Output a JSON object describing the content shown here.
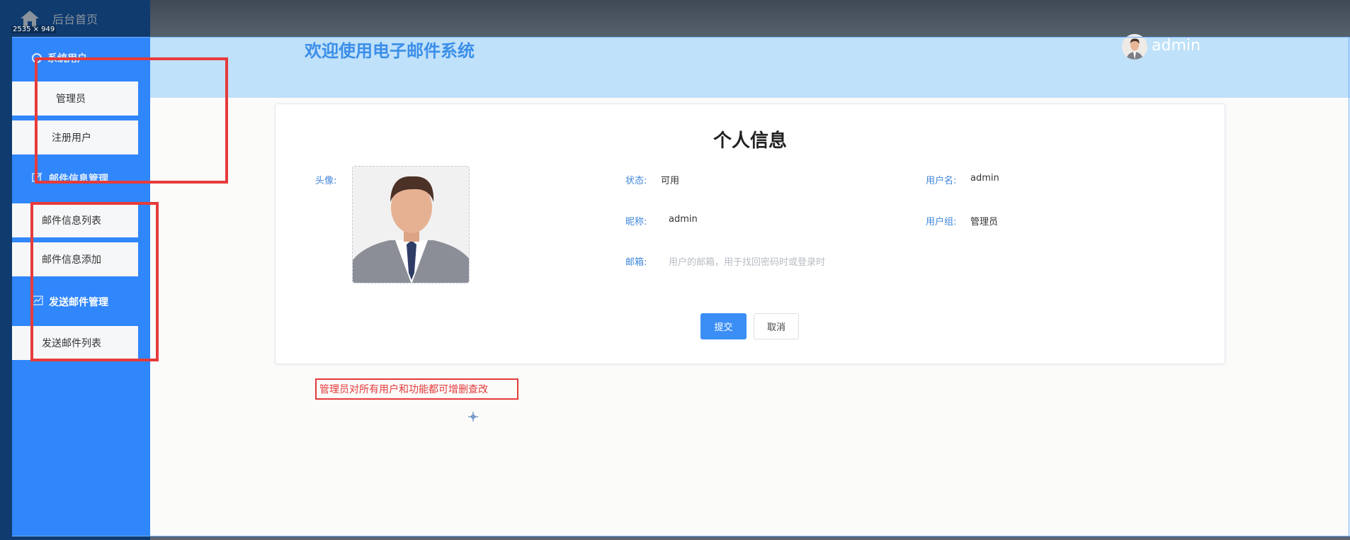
{
  "topbar": {
    "home_label": "后台首页",
    "dim_badge": "2535 × 949"
  },
  "sidebar": {
    "groups": [
      {
        "label": "系统用户",
        "icon": "user-icon"
      },
      {
        "label": "邮件信息管理",
        "icon": "edit-icon"
      },
      {
        "label": "发送邮件管理",
        "icon": "chart-icon"
      }
    ],
    "items": [
      {
        "label": "管理员"
      },
      {
        "label": "注册用户"
      },
      {
        "label": "邮件信息列表"
      },
      {
        "label": "邮件信息添加"
      },
      {
        "label": "发送邮件列表"
      }
    ]
  },
  "header": {
    "title": "欢迎使用电子邮件系统",
    "user": "admin"
  },
  "profile": {
    "title": "个人信息",
    "avatar_label": "头像:",
    "status_label": "状态:",
    "status_value": "可用",
    "username_label": "用户名:",
    "username_value": "admin",
    "nickname_label": "昵称:",
    "nickname_value": "admin",
    "group_label": "用户组:",
    "group_value": "管理员",
    "email_label": "邮箱:",
    "email_placeholder": "用户的邮箱，用于找回密码时或登录时",
    "submit": "提交",
    "cancel": "取消"
  },
  "annotation": {
    "note": "管理员对所有用户和功能都可增删查改"
  },
  "colors": {
    "sidebar_blue": "#3086fb",
    "header_band": "#bfe1f9",
    "accent": "#3a8ef5",
    "annotation_red": "#e53a3a"
  }
}
